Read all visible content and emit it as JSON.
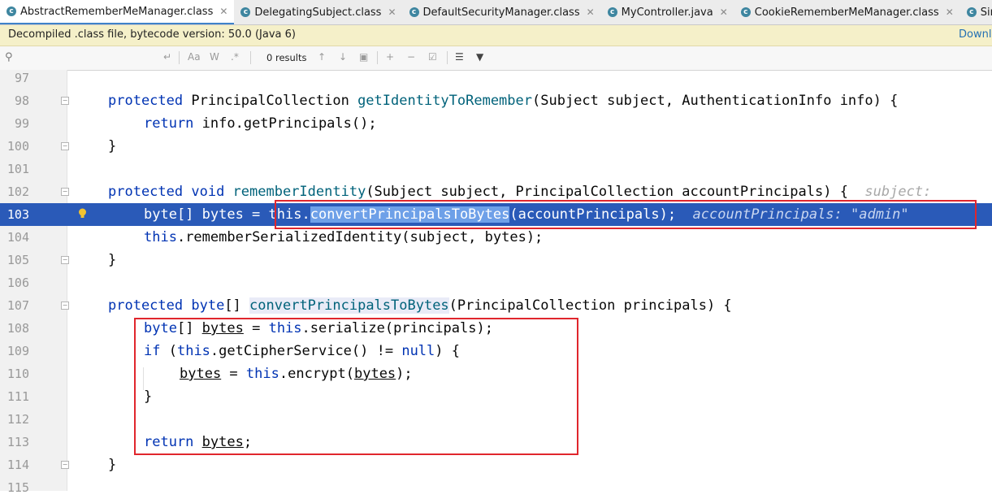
{
  "tabs": [
    {
      "label": "AbstractRememberMeManager.class",
      "active": true,
      "close": "✕"
    },
    {
      "label": "DelegatingSubject.class",
      "active": false,
      "close": "✕"
    },
    {
      "label": "DefaultSecurityManager.class",
      "active": false,
      "close": "✕"
    },
    {
      "label": "MyController.java",
      "active": false,
      "close": "✕"
    },
    {
      "label": "CookieRememberMeManager.class",
      "active": false,
      "close": "✕"
    },
    {
      "label": "SimpleCookie.class",
      "active": false,
      "close": ""
    }
  ],
  "banner": {
    "message": "Decompiled .class file, bytecode version: 50.0 (Java 6)",
    "link": "Downlo"
  },
  "search": {
    "placeholder": "",
    "match_case": "Aa",
    "words": "W",
    "regex": ".*",
    "results": "0 results"
  },
  "lines": [
    {
      "n": "97"
    },
    {
      "n": "98",
      "t1": "protected",
      "t2": " PrincipalCollection ",
      "t3": "getIdentityToRemember",
      "t4": "(Subject subject, AuthenticationInfo info) {"
    },
    {
      "n": "99",
      "t1": "return",
      "t2": " info.getPrincipals();"
    },
    {
      "n": "100",
      "t1": "}"
    },
    {
      "n": "101"
    },
    {
      "n": "102",
      "t1": "protected",
      "t2": " void ",
      "t3": "rememberIdentity",
      "t4": "(Subject subject, PrincipalCollection accountPrincipals) {",
      "hint": "subject:"
    },
    {
      "n": "103",
      "a": "byte[] bytes = ",
      "b": "this.",
      "c": "convertPrincipalsToBytes",
      "d": "(accountPrincipals);",
      "hint": "accountPrincipals: \"admin\""
    },
    {
      "n": "104",
      "t1": "this",
      "t2": ".rememberSerializedIdentity(subject, bytes);"
    },
    {
      "n": "105",
      "t1": "}"
    },
    {
      "n": "106"
    },
    {
      "n": "107",
      "t1": "protected",
      "t2": " byte",
      "t3": "[] ",
      "t4": "convertPrincipalsToBytes",
      "t5": "(PrincipalCollection principals) {"
    },
    {
      "n": "108",
      "t1": "byte",
      "t2": "[] ",
      "t3": "bytes",
      "t4": " = ",
      "t5": "this",
      "t6": ".serialize(principals);"
    },
    {
      "n": "109",
      "t1": "if",
      "t2": " (",
      "t3": "this",
      "t4": ".getCipherService() != ",
      "t5": "null",
      "t6": ") {"
    },
    {
      "n": "110",
      "t1": "bytes",
      "t2": " = ",
      "t3": "this",
      "t4": ".encrypt(",
      "t5": "bytes",
      "t6": ");"
    },
    {
      "n": "111",
      "t1": "}"
    },
    {
      "n": "112"
    },
    {
      "n": "113",
      "t1": "return",
      "t2": " ",
      "t3": "bytes",
      "t4": ";"
    },
    {
      "n": "114",
      "t1": "}"
    },
    {
      "n": "115"
    }
  ],
  "colors": {
    "keyword": "#0033b3",
    "method": "#00627a",
    "selection": "#2a5ab8",
    "annotation_box": "#e0262d"
  }
}
